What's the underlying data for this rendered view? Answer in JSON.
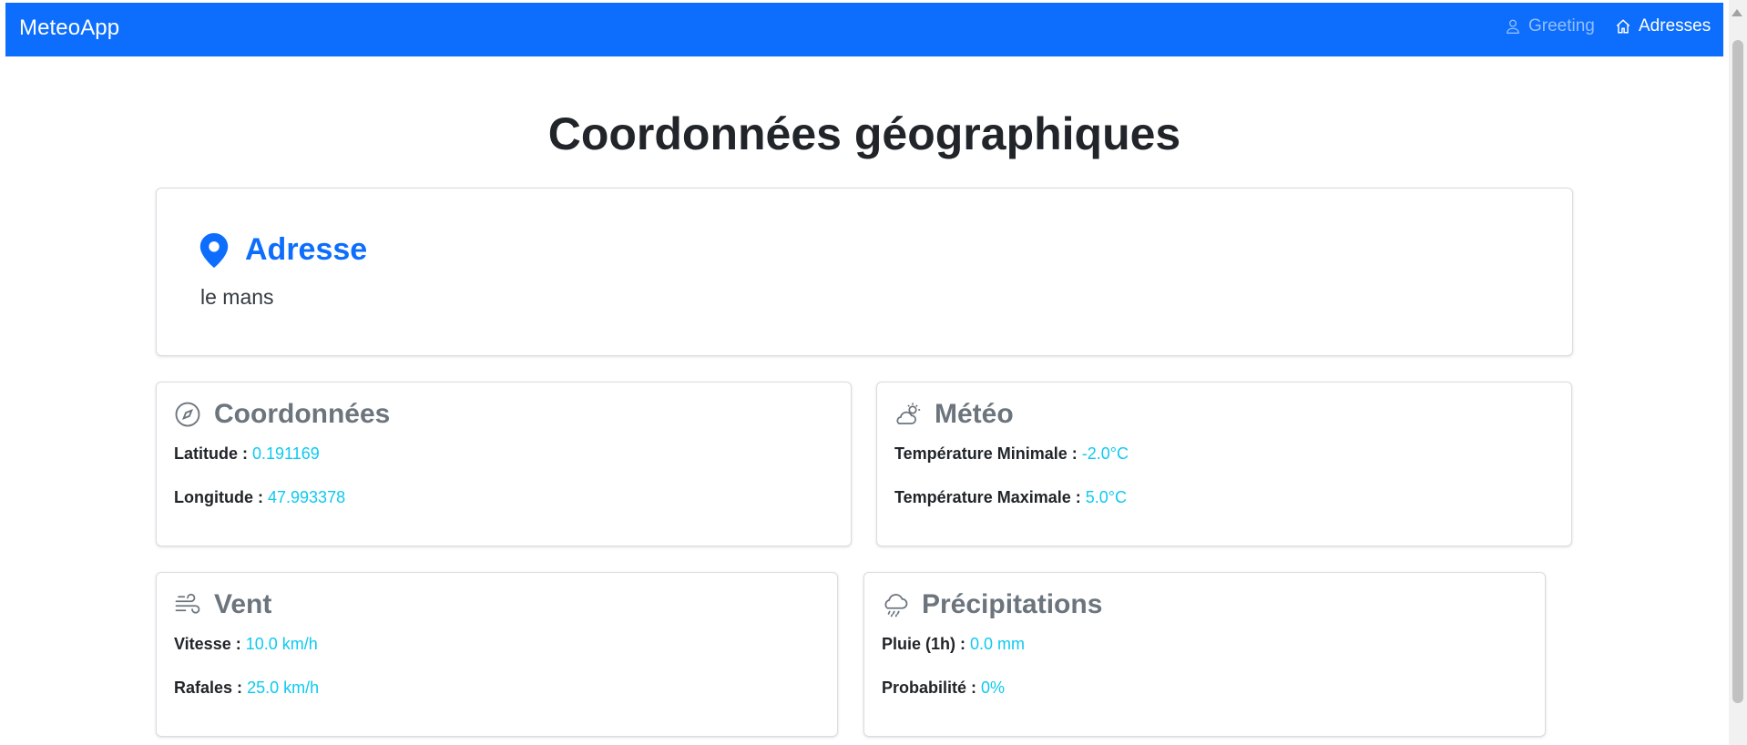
{
  "navbar": {
    "brand": "MeteoApp",
    "links": [
      {
        "label": "Greeting",
        "icon": "person-icon",
        "active": false
      },
      {
        "label": "Adresses",
        "icon": "house-icon",
        "active": true
      }
    ]
  },
  "page": {
    "title": "Coordonnées géographiques"
  },
  "address": {
    "title": "Adresse",
    "icon": "geo-pin-icon",
    "value": "le mans"
  },
  "coordinates": {
    "title": "Coordonnées",
    "icon": "compass-icon",
    "latitude_label": "Latitude :",
    "latitude_value": "0.191169",
    "longitude_label": "Longitude :",
    "longitude_value": "47.993378"
  },
  "meteo": {
    "title": "Météo",
    "icon": "cloud-sun-icon",
    "tmin_label": "Température Minimale :",
    "tmin_value": "-2.0°C",
    "tmax_label": "Température Maximale :",
    "tmax_value": "5.0°C"
  },
  "wind": {
    "title": "Vent",
    "icon": "wind-icon",
    "speed_label": "Vitesse :",
    "speed_value": "10.0 km/h",
    "gust_label": "Rafales :",
    "gust_value": "25.0 km/h"
  },
  "precipitation": {
    "title": "Précipitations",
    "icon": "cloud-rain-icon",
    "rain_label": "Pluie (1h) :",
    "rain_value": "0.0 mm",
    "prob_label": "Probabilité :",
    "prob_value": "0%"
  },
  "colors": {
    "primary": "#0d6efd",
    "info": "#0dcaf0",
    "muted": "#6c757d"
  }
}
